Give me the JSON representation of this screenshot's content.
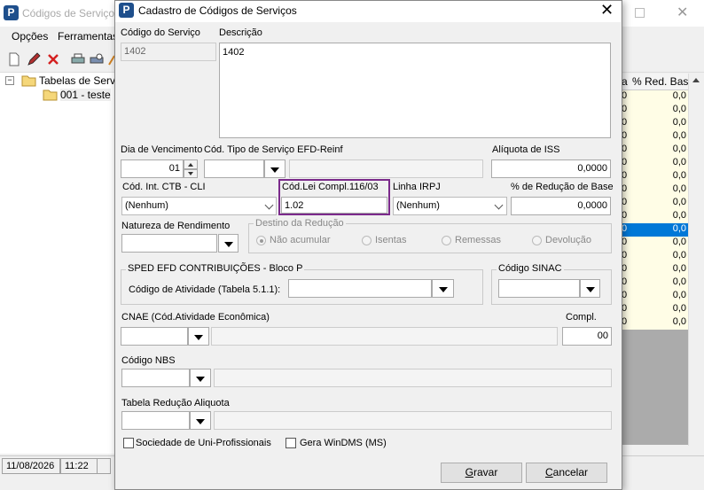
{
  "bg_window": {
    "title": "Códigos de Serviços",
    "menu": [
      "Opções",
      "Ferramentas"
    ],
    "tree": {
      "root": "Tabelas de Serviç",
      "child": "001 - teste"
    },
    "grid": {
      "col_a": "a",
      "col_b": "% Red. Bas",
      "rows": [
        {
          "a": "0",
          "b": "0,0"
        },
        {
          "a": "0",
          "b": "0,0"
        },
        {
          "a": "0",
          "b": "0,0"
        },
        {
          "a": "0",
          "b": "0,0"
        },
        {
          "a": "0",
          "b": "0,0"
        },
        {
          "a": "0",
          "b": "0,0"
        },
        {
          "a": "0",
          "b": "0,0"
        },
        {
          "a": "0",
          "b": "0,0"
        },
        {
          "a": "0",
          "b": "0,0"
        },
        {
          "a": "0",
          "b": "0,0"
        },
        {
          "a": "0",
          "b": "0,0"
        },
        {
          "a": "0",
          "b": "0,0"
        },
        {
          "a": "0",
          "b": "0,0"
        },
        {
          "a": "0",
          "b": "0,0"
        },
        {
          "a": "0",
          "b": "0,0"
        },
        {
          "a": "0",
          "b": "0,0"
        },
        {
          "a": "0",
          "b": "0,0"
        },
        {
          "a": "0",
          "b": "0,0"
        }
      ],
      "selected_row": 10
    },
    "status": {
      "date": "11/08/2026",
      "time": "11:22"
    }
  },
  "dialog": {
    "title": "Cadastro de Códigos de Serviços",
    "codigo_servico": {
      "label": "Código do Serviço",
      "value": "1402"
    },
    "descricao": {
      "label": "Descrição",
      "value": "1402"
    },
    "dia_vencimento": {
      "label": "Dia de Vencimento",
      "value": "01"
    },
    "tipo_servico_reinf": {
      "label": "Cód. Tipo de Serviço EFD-Reinf",
      "value": "",
      "desc": ""
    },
    "aliquota_iss": {
      "label": "Alíquota de ISS",
      "value": "0,0000"
    },
    "cod_ctb": {
      "label": "Cód. Int. CTB - CLI",
      "value": "(Nenhum)"
    },
    "cod_lei": {
      "label": "Cód.Lei Compl.116/03",
      "value": "1.02"
    },
    "linha_irpj": {
      "label": "Linha IRPJ",
      "value": "(Nenhum)"
    },
    "reducao_base": {
      "label": "% de Redução de Base",
      "value": "0,0000"
    },
    "natureza": {
      "label": "Natureza de Rendimento",
      "value": ""
    },
    "destino": {
      "label": "Destino da Redução",
      "options": [
        "Não acumular",
        "Isentas",
        "Remessas",
        "Devolução"
      ],
      "selected": 0
    },
    "sped": {
      "label": "SPED EFD CONTRIBUIÇÕES - Bloco P",
      "atividade_label": "Código de Atividade (Tabela 5.1.1):",
      "atividade_value": ""
    },
    "sinac": {
      "label": "Código SINAC",
      "value": ""
    },
    "cnae": {
      "label": "CNAE (Cód.Atividade Econômica)",
      "value": "",
      "desc": ""
    },
    "compl": {
      "label": "Compl.",
      "value": "00"
    },
    "nbs": {
      "label": "Código NBS",
      "value": "",
      "desc": ""
    },
    "tabela_reducao": {
      "label": "Tabela Redução Aliquota",
      "value": "",
      "desc": ""
    },
    "sociedade": {
      "label": "Sociedade de Uni-Profissionais",
      "checked": false
    },
    "windms": {
      "label": "Gera WinDMS (MS)",
      "checked": false
    },
    "gravar": {
      "mnemonic": "G",
      "rest": "ravar"
    },
    "cancelar": {
      "mnemonic": "C",
      "rest": "ancelar"
    }
  }
}
